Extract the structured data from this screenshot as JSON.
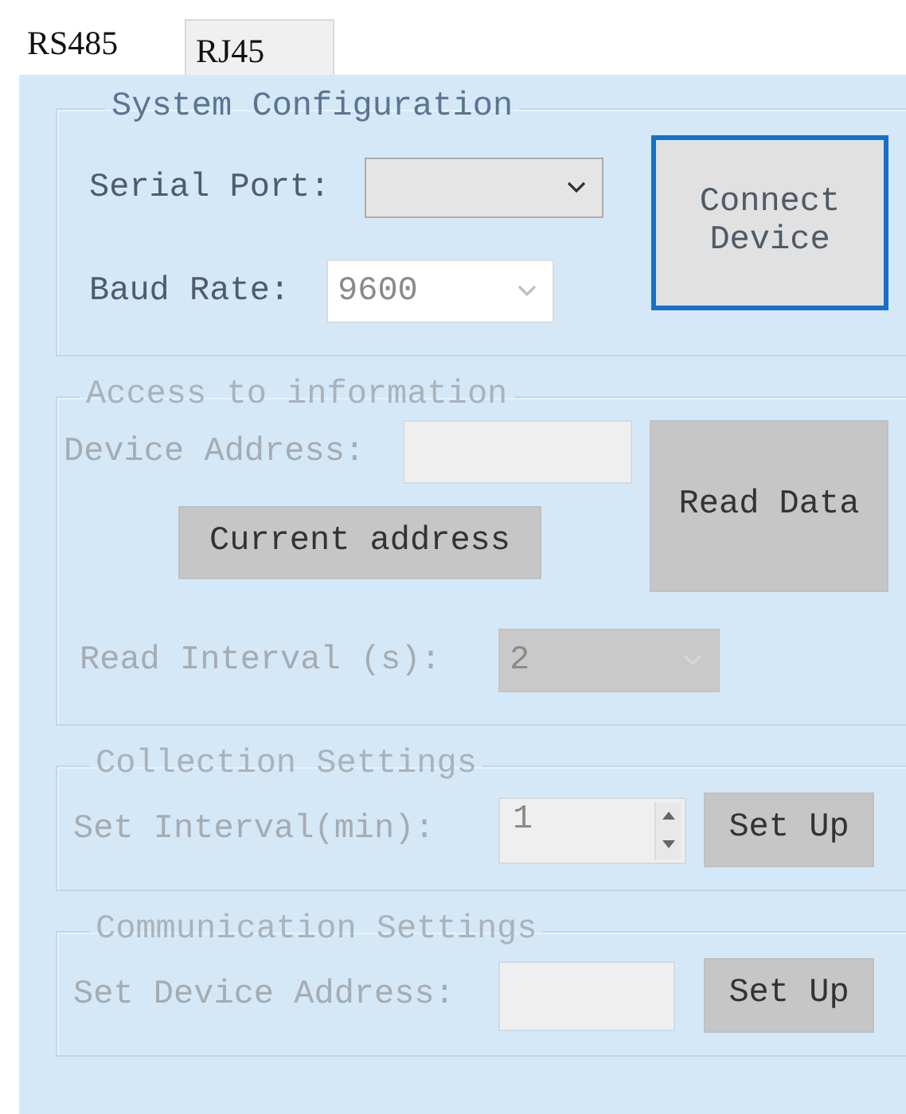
{
  "tabs": [
    {
      "label": "RS485",
      "selected": true
    },
    {
      "label": "RJ45",
      "selected": false
    }
  ],
  "system_configuration": {
    "title": "System Configuration",
    "disabled": false,
    "serial_port": {
      "label": "Serial Port:"
    },
    "baud_rate": {
      "label": "Baud Rate:",
      "value": "9600"
    },
    "connect_button": {
      "label": "Connect Device",
      "focused": true
    }
  },
  "access_to_information": {
    "title": "Access to information",
    "disabled": true,
    "device_address": {
      "label": "Device Address:"
    },
    "current_address_button": {
      "label": "Current address"
    },
    "read_data_button": {
      "label": "Read Data"
    },
    "read_interval": {
      "label": "Read Interval (s):",
      "value": "2"
    }
  },
  "collection_settings": {
    "title": "Collection Settings",
    "disabled": true,
    "set_interval": {
      "label": "Set Interval(min):",
      "value": "1"
    },
    "set_up_button": {
      "label": "Set Up"
    }
  },
  "communication_settings": {
    "title": "Communication Settings",
    "disabled": true,
    "set_device_address": {
      "label": "Set Device Address:"
    },
    "set_up_button": {
      "label": "Set Up"
    }
  }
}
